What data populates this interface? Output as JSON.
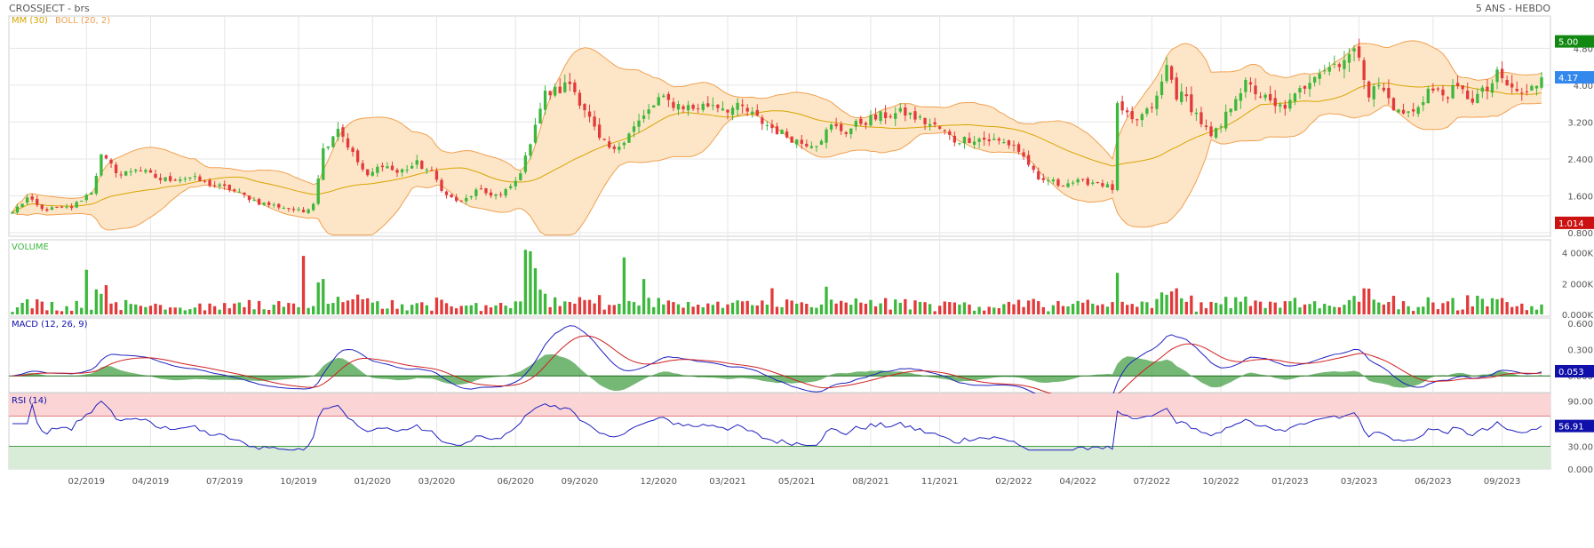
{
  "header": {
    "title": "CROSSJECT - brs",
    "period": "5 ANS - HEBDO"
  },
  "colors": {
    "up": "#3cb83c",
    "down": "#e23a3a",
    "ma": "#d9a400",
    "boll_fill": "#fde6c8",
    "boll_line": "#f0a050",
    "macd": "#2020c0",
    "signal": "#d02020",
    "hist": "#3a9a3a",
    "rsi": "#2020c0",
    "rsi_high_zone": "#fbd5d5",
    "rsi_low_zone": "#d8ecd8",
    "tag_high": "#118811",
    "tag_low": "#cc1111",
    "tag_last": "#3388ee",
    "tag_macd": "#1010aa",
    "tag_rsi": "#1010aa"
  },
  "chart_data": [
    {
      "type": "candlestick",
      "panel": "price",
      "legend": [
        {
          "label": "MM (30)",
          "color": "#d9a400"
        },
        {
          "label": "BOLL (20, 2)",
          "color": "#f0a050"
        }
      ],
      "ylim": [
        0.8,
        5.0
      ],
      "y_ticks": [
        "0.800",
        "1.600",
        "2.400",
        "3.200",
        "4.00",
        "4.80"
      ],
      "price_tags": {
        "high": "5.00",
        "last": "4.17",
        "low": "1.014"
      },
      "close_keyframes": [
        [
          0,
          1.25
        ],
        [
          3,
          1.55
        ],
        [
          6,
          1.3
        ],
        [
          12,
          1.35
        ],
        [
          16,
          1.7
        ],
        [
          18,
          2.45
        ],
        [
          22,
          2.05
        ],
        [
          25,
          2.2
        ],
        [
          30,
          1.95
        ],
        [
          36,
          2.0
        ],
        [
          40,
          1.85
        ],
        [
          44,
          1.75
        ],
        [
          47,
          1.6
        ],
        [
          50,
          1.45
        ],
        [
          55,
          1.35
        ],
        [
          59,
          1.25
        ],
        [
          61,
          1.45
        ],
        [
          63,
          2.6
        ],
        [
          66,
          3.1
        ],
        [
          69,
          2.5
        ],
        [
          72,
          2.0
        ],
        [
          75,
          2.3
        ],
        [
          78,
          2.1
        ],
        [
          82,
          2.3
        ],
        [
          85,
          2.1
        ],
        [
          88,
          1.6
        ],
        [
          91,
          1.45
        ],
        [
          94,
          1.7
        ],
        [
          99,
          1.6
        ],
        [
          102,
          1.9
        ],
        [
          104,
          2.4
        ],
        [
          106,
          3.2
        ],
        [
          108,
          3.8
        ],
        [
          111,
          3.9
        ],
        [
          113,
          4.05
        ],
        [
          116,
          3.5
        ],
        [
          119,
          2.8
        ],
        [
          122,
          2.55
        ],
        [
          125,
          3.0
        ],
        [
          128,
          3.3
        ],
        [
          131,
          3.7
        ],
        [
          134,
          3.6
        ],
        [
          138,
          3.5
        ],
        [
          142,
          3.6
        ],
        [
          145,
          3.5
        ],
        [
          148,
          3.5
        ],
        [
          152,
          3.2
        ],
        [
          156,
          2.95
        ],
        [
          160,
          2.75
        ],
        [
          163,
          2.75
        ],
        [
          166,
          3.1
        ],
        [
          169,
          3.0
        ],
        [
          172,
          3.2
        ],
        [
          177,
          3.35
        ],
        [
          181,
          3.4
        ],
        [
          185,
          3.2
        ],
        [
          188,
          3.05
        ],
        [
          191,
          2.8
        ],
        [
          195,
          2.85
        ],
        [
          199,
          2.8
        ],
        [
          203,
          2.7
        ],
        [
          206,
          2.3
        ],
        [
          208,
          1.9
        ],
        [
          210,
          1.95
        ],
        [
          212,
          1.85
        ],
        [
          215,
          1.9
        ],
        [
          220,
          1.9
        ],
        [
          223,
          1.75
        ],
        [
          224,
          3.5
        ],
        [
          227,
          3.2
        ],
        [
          230,
          3.4
        ],
        [
          232,
          3.7
        ],
        [
          234,
          4.4
        ],
        [
          236,
          3.8
        ],
        [
          238,
          3.7
        ],
        [
          241,
          3.2
        ],
        [
          243,
          2.85
        ],
        [
          245,
          3.1
        ],
        [
          248,
          3.8
        ],
        [
          250,
          4.0
        ],
        [
          253,
          3.8
        ],
        [
          256,
          3.5
        ],
        [
          259,
          3.6
        ],
        [
          262,
          4.0
        ],
        [
          264,
          4.3
        ],
        [
          267,
          4.4
        ],
        [
          270,
          4.6
        ],
        [
          273,
          4.7
        ],
        [
          275,
          3.8
        ],
        [
          277,
          4.0
        ],
        [
          279,
          3.7
        ],
        [
          281,
          3.4
        ],
        [
          284,
          3.4
        ],
        [
          287,
          3.9
        ],
        [
          290,
          3.8
        ],
        [
          293,
          3.9
        ],
        [
          296,
          3.7
        ],
        [
          299,
          3.9
        ],
        [
          301,
          4.2
        ],
        [
          304,
          3.9
        ],
        [
          307,
          3.8
        ],
        [
          310,
          4.17
        ]
      ],
      "volume_spikes": [
        [
          15,
          2900
        ],
        [
          19,
          1900
        ],
        [
          59,
          3800
        ],
        [
          104,
          4200
        ],
        [
          105,
          4100
        ],
        [
          106,
          3000
        ],
        [
          124,
          3700
        ],
        [
          128,
          2300
        ],
        [
          154,
          1700
        ],
        [
          165,
          1800
        ],
        [
          224,
          2700
        ],
        [
          272,
          1200
        ]
      ]
    },
    {
      "type": "bar",
      "panel": "volume",
      "title": "VOLUME",
      "y_ticks": [
        "0.000K",
        "2 000K",
        "4 000K"
      ],
      "ylim": [
        0,
        4500
      ]
    },
    {
      "type": "line",
      "panel": "macd",
      "title": "MACD (12, 26, 9)",
      "ylim": [
        -0.15,
        0.6
      ],
      "y_ticks": [
        "0.000",
        "0.300",
        "0.600"
      ],
      "last_tag": "0.053"
    },
    {
      "type": "line",
      "panel": "rsi",
      "title": "RSI (14)",
      "ylim": [
        0,
        100
      ],
      "y_ticks": [
        "0.000",
        "30.00",
        "90.00"
      ],
      "zones": {
        "upper": 70,
        "lower": 30
      },
      "last_tag": "56.91"
    }
  ],
  "x_axis": {
    "labels": [
      {
        "i": 15,
        "label": "02/2019"
      },
      {
        "i": 28,
        "label": "04/2019"
      },
      {
        "i": 43,
        "label": "07/2019"
      },
      {
        "i": 58,
        "label": "10/2019"
      },
      {
        "i": 73,
        "label": "01/2020"
      },
      {
        "i": 86,
        "label": "03/2020"
      },
      {
        "i": 102,
        "label": "06/2020"
      },
      {
        "i": 115,
        "label": "09/2020"
      },
      {
        "i": 131,
        "label": "12/2020"
      },
      {
        "i": 145,
        "label": "03/2021"
      },
      {
        "i": 159,
        "label": "05/2021"
      },
      {
        "i": 174,
        "label": "08/2021"
      },
      {
        "i": 188,
        "label": "11/2021"
      },
      {
        "i": 203,
        "label": "02/2022"
      },
      {
        "i": 216,
        "label": "04/2022"
      },
      {
        "i": 231,
        "label": "07/2022"
      },
      {
        "i": 245,
        "label": "10/2022"
      },
      {
        "i": 259,
        "label": "01/2023"
      },
      {
        "i": 273,
        "label": "03/2023"
      },
      {
        "i": 288,
        "label": "06/2023"
      },
      {
        "i": 302,
        "label": "09/2023"
      }
    ]
  }
}
